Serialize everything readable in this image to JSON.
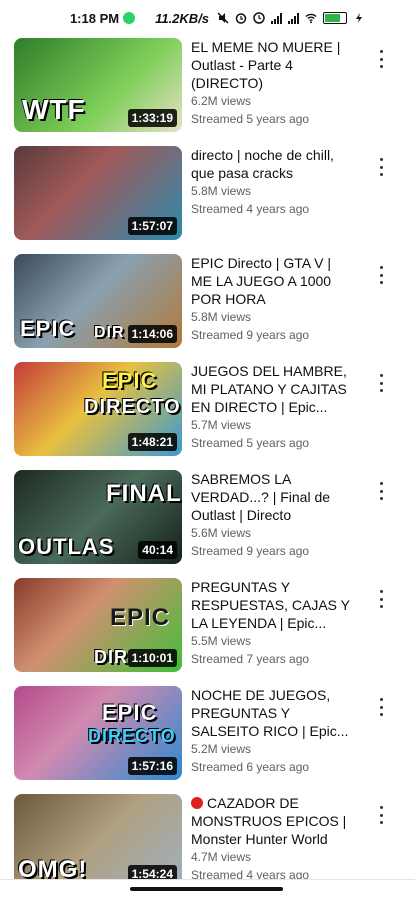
{
  "status_bar": {
    "time": "1:18 PM",
    "speed": "11.2KB/s",
    "battery_label": "",
    "colors": {
      "whatsapp": "#25d366",
      "battery": "#2fb34a"
    }
  },
  "videos": [
    {
      "title": "EL MEME NO MUERE | Outlast - Parte 4 (DIRECTO)",
      "views": "6.2M views",
      "streamed": "Streamed 5 years ago",
      "duration": "1:33:19",
      "thumb_caption": "WTF",
      "thumb_colors": [
        "#2f7d2a",
        "#7fcf5a"
      ]
    },
    {
      "title": "directo | noche de chill, que pasa cracks",
      "views": "5.8M views",
      "streamed": "Streamed 4 years ago",
      "duration": "1:57:07",
      "thumb_caption": "",
      "thumb_colors": [
        "#5a3a3a",
        "#2a8bb0"
      ]
    },
    {
      "title": "EPIC Directo | GTA V | ME LA JUEGO A 1000 POR HORA",
      "views": "5.8M views",
      "streamed": "Streamed 9 years ago",
      "duration": "1:14:06",
      "thumb_caption": "EPIC",
      "thumb_caption2": "DIR",
      "thumb_colors": [
        "#3a4a5a",
        "#b07a3a"
      ]
    },
    {
      "title": "JUEGOS DEL HAMBRE, MI PLATANO Y CAJITAS EN DIRECTO | Epic...",
      "views": "5.7M views",
      "streamed": "Streamed 5 years ago",
      "duration": "1:48:21",
      "thumb_caption": "EPIC",
      "thumb_caption2": "DIRECTO",
      "thumb_colors": [
        "#c43b3b",
        "#3a9ad0"
      ]
    },
    {
      "title": "SABREMOS LA VERDAD...? | Final de Outlast | Directo",
      "views": "5.6M views",
      "streamed": "Streamed 9 years ago",
      "duration": "40:14",
      "thumb_caption": "FINAL",
      "thumb_caption2": "OUTLAS",
      "thumb_colors": [
        "#1d2a22",
        "#4a6a5a"
      ]
    },
    {
      "title": "PREGUNTAS Y RESPUESTAS, CAJAS Y LA LEYENDA | Epic...",
      "views": "5.5M views",
      "streamed": "Streamed 7 years ago",
      "duration": "1:10:01",
      "thumb_caption": "EPIC",
      "thumb_caption2": "DIR",
      "thumb_colors": [
        "#8a3a2a",
        "#3fbf3a"
      ]
    },
    {
      "title": "NOCHE DE JUEGOS, PREGUNTAS Y SALSEITO RICO | Epic...",
      "views": "5.2M views",
      "streamed": "Streamed 6 years ago",
      "duration": "1:57:16",
      "thumb_caption": "EPIC",
      "thumb_caption2": "DIRECTO",
      "thumb_colors": [
        "#b44a8a",
        "#2a8ad0"
      ]
    },
    {
      "title": "CAZADOR DE MONSTRUOS EPICOS | Monster Hunter World",
      "views": "4.7M views",
      "streamed": "Streamed 4 years ago",
      "duration": "1:54:24",
      "thumb_caption": "OMG!",
      "thumb_colors": [
        "#6a5a3a",
        "#a0b0c0"
      ],
      "live_dot": true
    }
  ]
}
